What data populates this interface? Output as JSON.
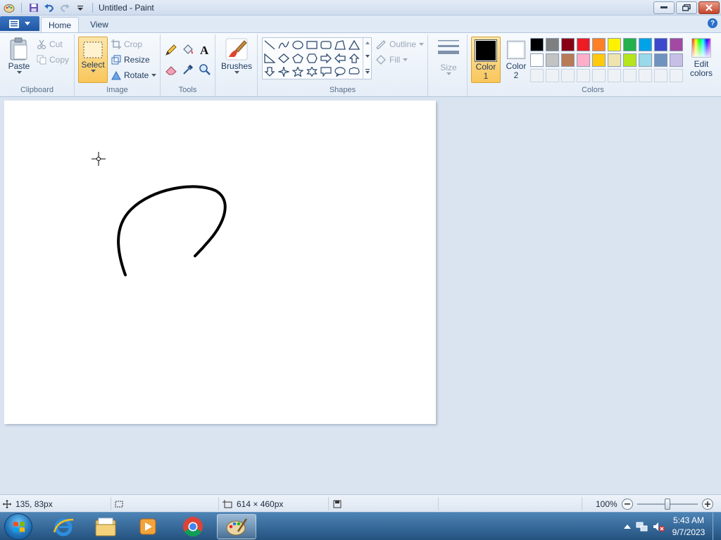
{
  "window": {
    "title": "Untitled - Paint"
  },
  "tabs": [
    {
      "label": "Home",
      "active": true
    },
    {
      "label": "View",
      "active": false
    }
  ],
  "clipboard": {
    "group_label": "Clipboard",
    "paste": "Paste",
    "cut": "Cut",
    "copy": "Copy"
  },
  "image": {
    "group_label": "Image",
    "select": "Select",
    "crop": "Crop",
    "resize": "Resize",
    "rotate": "Rotate"
  },
  "tools": {
    "group_label": "Tools"
  },
  "brushes": {
    "label": "Brushes"
  },
  "shapes": {
    "group_label": "Shapes",
    "outline": "Outline",
    "fill": "Fill"
  },
  "size": {
    "label": "Size"
  },
  "colors": {
    "group_label": "Colors",
    "color1_label_1": "Color",
    "color1_label_2": "1",
    "color2_label_1": "Color",
    "color2_label_2": "2",
    "edit_label_1": "Edit",
    "edit_label_2": "colors",
    "color1": "#000000",
    "color2": "#ffffff",
    "palette_row1": [
      "#000000",
      "#7f7f7f",
      "#880015",
      "#ed1c24",
      "#ff7f27",
      "#fff200",
      "#22b14c",
      "#00a2e8",
      "#3f48cc",
      "#a349a4"
    ],
    "palette_row2": [
      "#ffffff",
      "#c3c3c3",
      "#b97a57",
      "#ffaec9",
      "#ffc90e",
      "#efe4b0",
      "#b5e61d",
      "#99d9ea",
      "#7092be",
      "#c8bfe7"
    ]
  },
  "status": {
    "cursor_pos": "135, 83px",
    "canvas_size": "614 × 460px",
    "zoom": "100%",
    "zoom_level": 0.5
  },
  "taskbar": {
    "time": "5:43 AM",
    "date": "9/7/2023"
  }
}
